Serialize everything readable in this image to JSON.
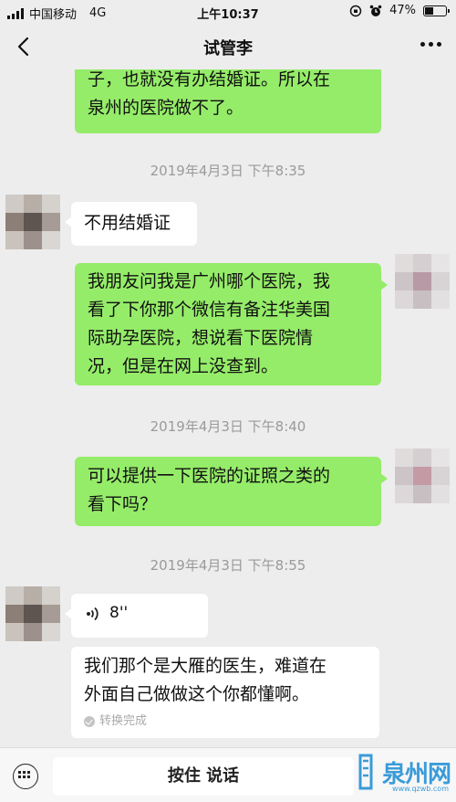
{
  "status_bar": {
    "carrier": "中国移动",
    "network": "4G",
    "time": "上午10:37",
    "battery": "47%",
    "battery_level": 0.47
  },
  "header": {
    "title": "试管李"
  },
  "messages": [
    {
      "line1": "子，也就没有办结婚证。所以在",
      "line2": "泉州的医院做不了。"
    },
    {
      "timestamp": "2019年4月3日 下午8:35"
    },
    {
      "text": "不用结婚证"
    },
    {
      "line1": "我朋友问我是广州哪个医院，我",
      "line2": "看了下你那个微信有备注华美国",
      "line3": "际助孕医院，想说看下医院情",
      "line4": "况，但是在网上没查到。"
    },
    {
      "timestamp": "2019年4月3日 下午8:40"
    },
    {
      "line1": "可以提供一下医院的证照之类的",
      "line2": "看下吗？"
    },
    {
      "timestamp": "2019年4月3日 下午8:55"
    },
    {
      "duration": "8''"
    },
    {
      "line1": "我们那个是大雁的医生，难道在",
      "line2": "外面自己做做这个你都懂啊。",
      "status": "转换完成"
    }
  ],
  "input_bar": {
    "hold_to_talk": "按住 说话"
  },
  "watermark": {
    "text": "泉州网",
    "url": "www.qzwb.com"
  }
}
